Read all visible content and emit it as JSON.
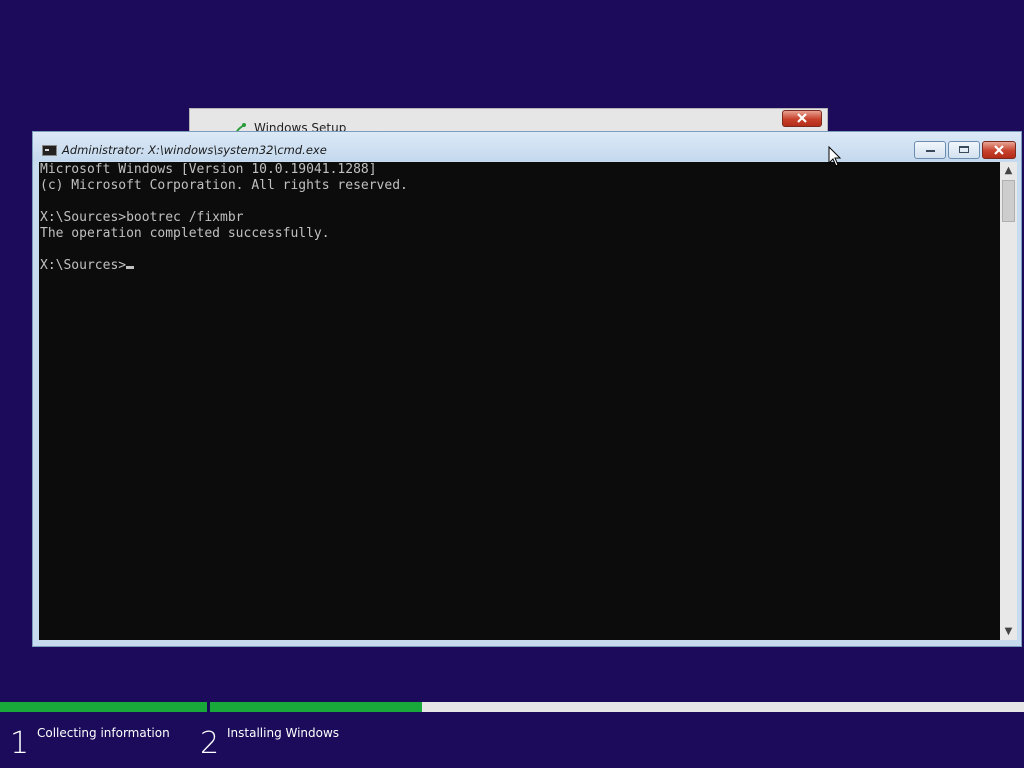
{
  "setup_window": {
    "title": "Windows Setup"
  },
  "cmd_window": {
    "title": "Administrator: X:\\windows\\system32\\cmd.exe",
    "lines": [
      "Microsoft Windows [Version 10.0.19041.1288]",
      "(c) Microsoft Corporation. All rights reserved.",
      "",
      "X:\\Sources>bootrec /fixmbr",
      "The operation completed successfully.",
      "",
      "X:\\Sources>"
    ]
  },
  "progress": {
    "steps": [
      {
        "number": "1",
        "label": "Collecting information",
        "fill": 1.0
      },
      {
        "number": "2",
        "label": "Installing Windows",
        "fill": 0.26
      }
    ]
  },
  "colors": {
    "desktop": "#1b0b5a",
    "progress_fill": "#19a83a",
    "console_bg": "#0c0c0c",
    "console_text": "#c0c0c0"
  },
  "icons": {
    "setup_icon": "windows-setup-icon",
    "cmd_icon": "command-prompt-icon",
    "pointer": "mouse-pointer-icon"
  }
}
